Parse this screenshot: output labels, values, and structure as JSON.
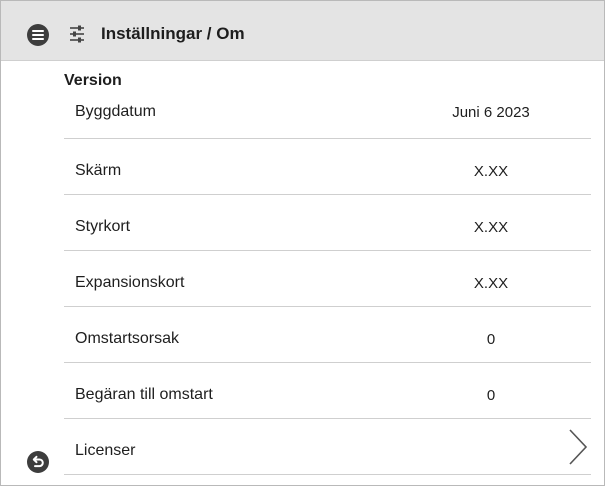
{
  "header": {
    "title": "Inställningar / Om",
    "menu_icon": "menu-icon",
    "settings_icon": "sliders-icon"
  },
  "section": {
    "title": "Version"
  },
  "rows": [
    {
      "label": "Byggdatum",
      "value": "Juni 6 2023"
    },
    {
      "label": "Skärm",
      "value": "X.XX"
    },
    {
      "label": "Styrkort",
      "value": "X.XX"
    },
    {
      "label": "Expansionskort",
      "value": "X.XX"
    },
    {
      "label": "Omstartsorsak",
      "value": "0"
    },
    {
      "label": "Begäran till omstart",
      "value": "0"
    },
    {
      "label": "Licenser",
      "value": ""
    }
  ],
  "footer": {
    "back_icon": "back-icon"
  },
  "colors": {
    "header_bg": "#e4e4e4",
    "icon_dark": "#3d3d3d",
    "divider": "#cfcfcf"
  }
}
